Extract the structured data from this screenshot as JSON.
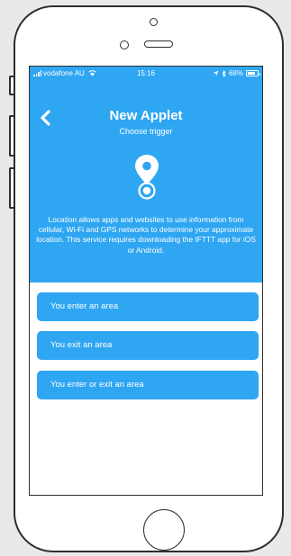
{
  "status_bar": {
    "carrier": "vodafone AU",
    "time": "15:16",
    "battery": "68%"
  },
  "header": {
    "title": "New Applet",
    "subtitle": "Choose trigger"
  },
  "service": {
    "description": "Location allows apps and websites to use information from cellular, Wi-Fi and GPS networks to determine your approximate location. This service requires downloading the IFTTT app for iOS or Android."
  },
  "triggers": [
    {
      "label": "You enter an area"
    },
    {
      "label": "You exit an area"
    },
    {
      "label": "You enter or exit an area"
    }
  ],
  "icons": {
    "back": "chevron-left-icon",
    "service": "location-pin-icon",
    "signal": "signal-icon",
    "wifi": "wifi-icon",
    "location_arrow": "location-arrow-icon",
    "bluetooth": "bluetooth-icon",
    "battery": "battery-icon"
  },
  "colors": {
    "accent": "#2fa6f2",
    "text_on_accent": "#ffffff",
    "frame": "#2e2e2e",
    "background": "#e9e9e9"
  }
}
